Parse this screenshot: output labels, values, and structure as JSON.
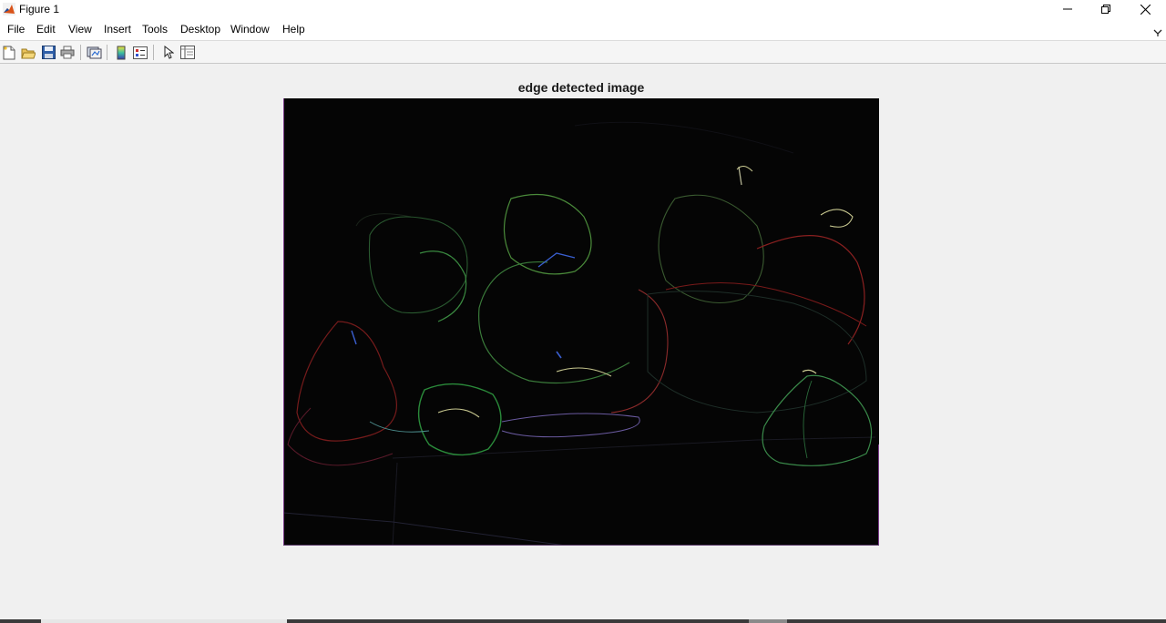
{
  "window": {
    "title": "Figure 1",
    "accent": "#d95319"
  },
  "menu": {
    "items": [
      "File",
      "Edit",
      "View",
      "Insert",
      "Tools",
      "Desktop",
      "Window",
      "Help"
    ]
  },
  "toolbar": {
    "buttons": [
      "new-figure-icon",
      "open-file-icon",
      "save-icon",
      "print-icon",
      "link-plot-icon",
      "colorbar-icon",
      "legend-icon",
      "edit-plot-icon",
      "property-inspector-icon"
    ]
  },
  "axes": {
    "title": "edge detected image"
  },
  "image": {
    "description_colors": [
      "#1f3a2a",
      "#b02020",
      "#2d9a3a",
      "#3a5fd0",
      "#c8c890",
      "#9a3ab0"
    ]
  }
}
